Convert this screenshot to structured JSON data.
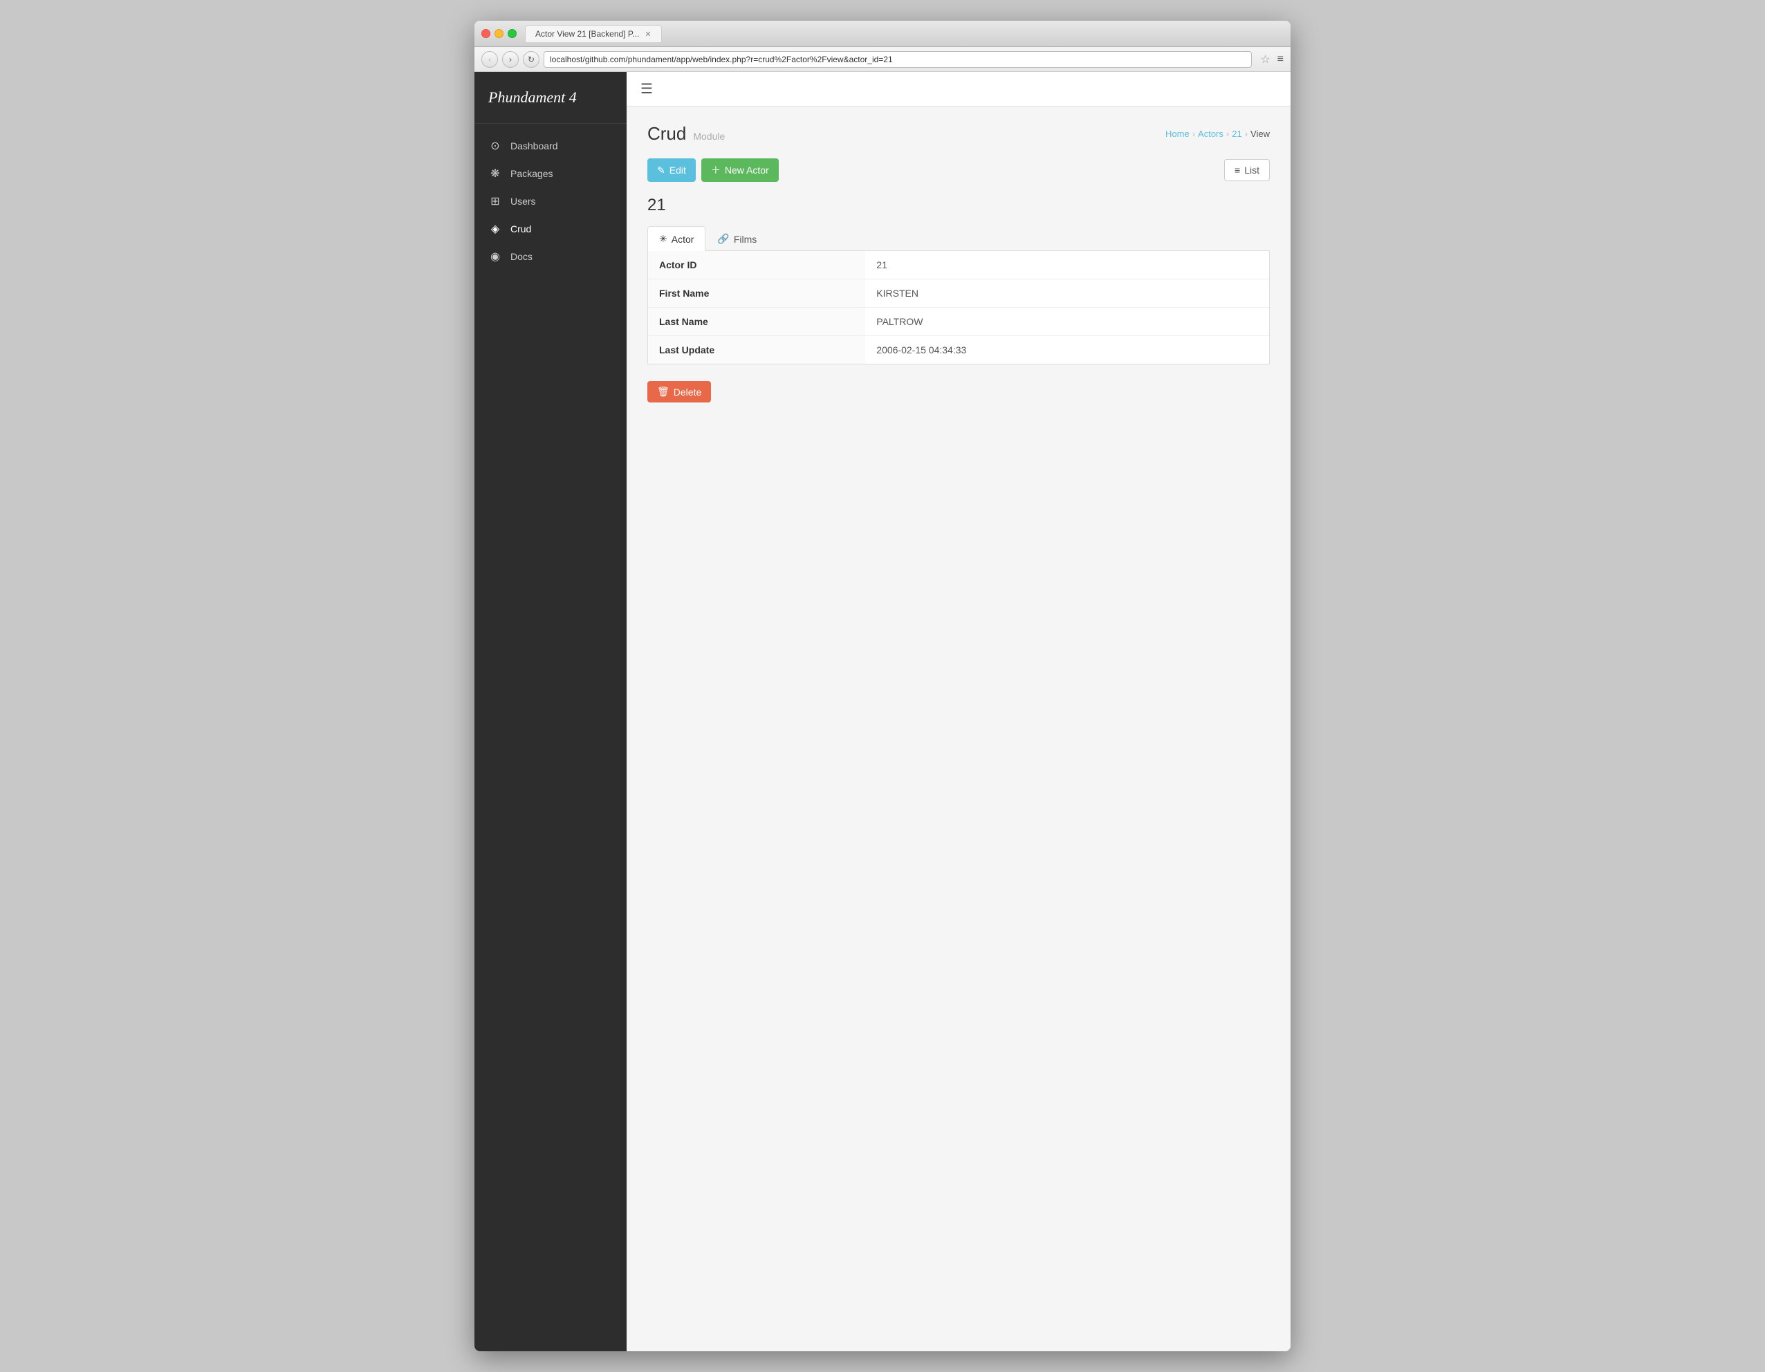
{
  "browser": {
    "tab_title": "Actor View 21 [Backend] P...",
    "url": "localhost/github.com/phundament/app/web/index.php?r=crud%2Factor%2Fview&actor_id=21"
  },
  "sidebar": {
    "brand": "Phundament 4",
    "nav_items": [
      {
        "id": "dashboard",
        "label": "Dashboard",
        "icon": "⊙"
      },
      {
        "id": "packages",
        "label": "Packages",
        "icon": "⊛"
      },
      {
        "id": "users",
        "label": "Users",
        "icon": "⊞"
      },
      {
        "id": "crud",
        "label": "Crud",
        "icon": "◈"
      },
      {
        "id": "docs",
        "label": "Docs",
        "icon": "◉"
      }
    ]
  },
  "page": {
    "module_label": "Crud",
    "module_sub": "Module",
    "breadcrumb": {
      "home": "Home",
      "actors": "Actors",
      "id": "21",
      "view": "View"
    },
    "record_id": "21",
    "buttons": {
      "edit": "✎ Edit",
      "edit_label": "Edit",
      "new_actor": "New Actor",
      "list": "List",
      "delete": "Delete"
    },
    "tabs": [
      {
        "id": "actor",
        "label": "Actor",
        "icon": "✳",
        "active": true
      },
      {
        "id": "films",
        "label": "Films",
        "icon": "🔗",
        "active": false
      }
    ],
    "fields": [
      {
        "label": "Actor ID",
        "value": "21"
      },
      {
        "label": "First Name",
        "value": "KIRSTEN"
      },
      {
        "label": "Last Name",
        "value": "PALTROW"
      },
      {
        "label": "Last Update",
        "value": "2006-02-15 04:34:33"
      }
    ]
  }
}
